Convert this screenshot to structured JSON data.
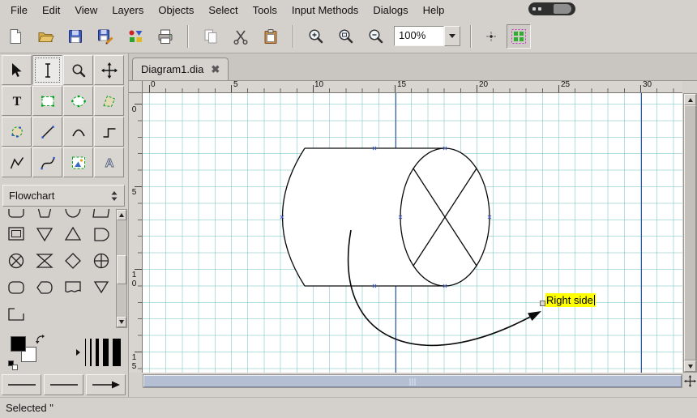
{
  "menubar": {
    "items": [
      {
        "label": "File"
      },
      {
        "label": "Edit"
      },
      {
        "label": "View"
      },
      {
        "label": "Layers"
      },
      {
        "label": "Objects"
      },
      {
        "label": "Select"
      },
      {
        "label": "Tools"
      },
      {
        "label": "Input Methods"
      },
      {
        "label": "Dialogs"
      },
      {
        "label": "Help"
      }
    ]
  },
  "toolbar": {
    "zoom_value": "100%",
    "icons": [
      "new-document",
      "open-diagram",
      "save-diagram",
      "save-as",
      "export",
      "print",
      "copy",
      "cut",
      "paste",
      "zoom-in",
      "zoom-fit",
      "zoom-out",
      "snap-to-objects",
      "snap-to-grid"
    ]
  },
  "toolbox": {
    "tools": [
      "modify",
      "text-edit",
      "magnify",
      "scroll",
      "text",
      "box",
      "ellipse",
      "polygon",
      "beziergon",
      "line",
      "arc",
      "zigzagline",
      "polyline",
      "bezierline",
      "image",
      "outline"
    ],
    "active_tool": "text-edit",
    "sheet_selector": "Flowchart",
    "shapes": [
      "double-box",
      "merge",
      "extract",
      "delay",
      "summing-junction",
      "collate",
      "sort",
      "or",
      "rounded-box",
      "display",
      "tape",
      "merge-small",
      "open-frame"
    ],
    "foreground_color": "#000000",
    "background_color": "#ffffff"
  },
  "document": {
    "tab_title": "Diagram1.dia"
  },
  "rulers": {
    "horizontal": [
      "0",
      "5",
      "10",
      "15",
      "20",
      "25",
      "30"
    ],
    "vertical": [
      "0",
      "5",
      "10",
      "15"
    ]
  },
  "canvas": {
    "annotation_text": "Right side",
    "annotation_highlight": "#ffff00",
    "guide_color": "#3b50a6",
    "grid_color": "#78c3c3"
  },
  "statusbar": {
    "text": "Selected \""
  }
}
